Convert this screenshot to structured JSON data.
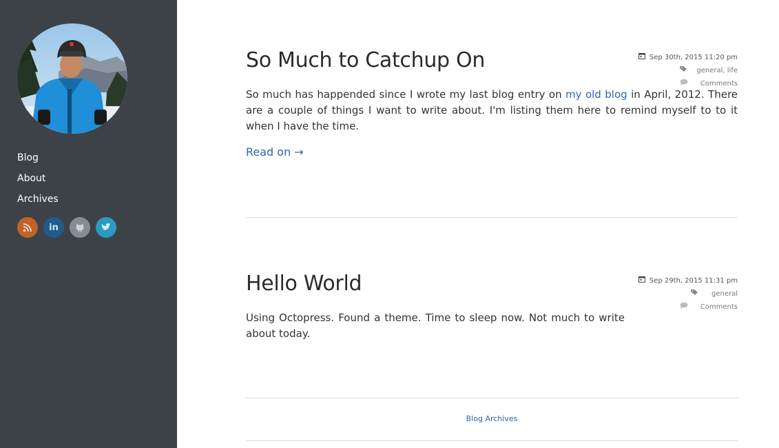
{
  "sidebar": {
    "nav": [
      "Blog",
      "About",
      "Archives"
    ],
    "social_icons": [
      {
        "name": "rss-icon",
        "color": "#c1622a"
      },
      {
        "name": "linkedin-icon",
        "color": "#1f5c8a"
      },
      {
        "name": "github-icon",
        "color": "#858c94"
      },
      {
        "name": "twitter-icon",
        "color": "#2b9ac3"
      }
    ]
  },
  "posts": [
    {
      "title": "So Much to Catchup On",
      "date": "Sep 30th, 2015 11:20 pm",
      "tags": [
        "general",
        "life"
      ],
      "comments": "Comments",
      "excerpt_before": "So much has happended since I wrote my last blog entry on ",
      "excerpt_link": "my old blog",
      "excerpt_after": " in April, 2012. There are a couple of things I want to write about. I'm listing them here to remind myself to to it when I have the time.",
      "read_on": "Read on →"
    },
    {
      "title": "Hello World",
      "date": "Sep 29th, 2015 11:31 pm",
      "tags": [
        "general"
      ],
      "comments": "Comments",
      "excerpt": "Using Octopress. Found a theme. Time to sleep now. Not much to write about today."
    }
  ],
  "footer": {
    "archives_link": "Blog Archives"
  },
  "colors": {
    "sidebar_bg": "#3d4249",
    "link": "#2d66b0",
    "rule": "#dcdcdc"
  }
}
